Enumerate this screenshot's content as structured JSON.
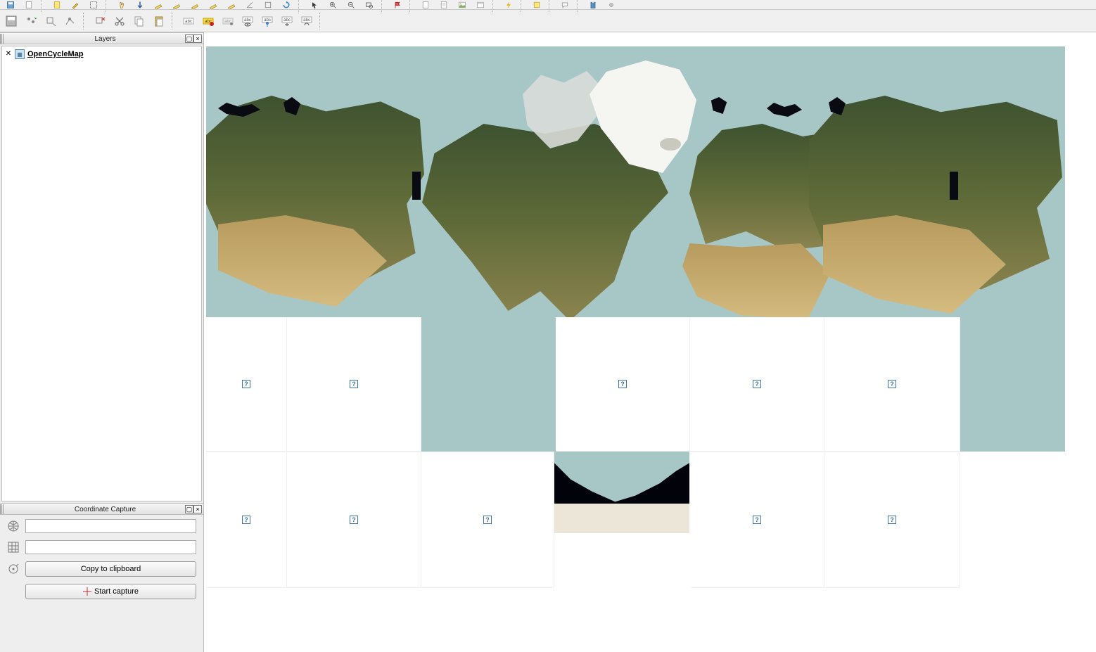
{
  "panels": {
    "layers": {
      "title": "Layers"
    },
    "coord": {
      "title": "Coordinate Capture"
    }
  },
  "layers": {
    "items": [
      {
        "name": "OpenCycleMap"
      }
    ]
  },
  "coord_capture": {
    "field1": "",
    "field2": "",
    "copy_label": "Copy to clipboard",
    "start_label": "Start capture"
  },
  "icons": {
    "missing_tile": "?"
  }
}
